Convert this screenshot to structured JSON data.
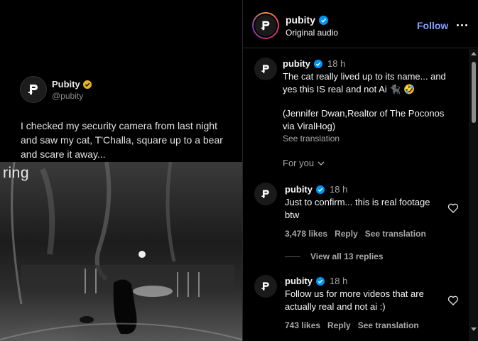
{
  "media": {
    "tweet": {
      "name": "Pubity",
      "handle": "@pubity",
      "text": "I checked my security camera from last night and saw my cat, T'Challa, square up to a bear and scare it away..."
    },
    "watermark": "ring"
  },
  "header": {
    "username": "pubity",
    "subtitle": "Original audio",
    "follow_label": "Follow",
    "more_icon": "more-horizontal-icon"
  },
  "caption": {
    "username": "pubity",
    "time": "18 h",
    "line1": "The cat really lived up to its name... and",
    "line2": "yes this IS real and not Ai 🐈‍⬛ 🤣",
    "line3": "(Jennifer Dwan,Realtor of The Poconos",
    "line4": "via ViralHog)",
    "see_translation": "See translation"
  },
  "for_you_label": "For you",
  "comments": [
    {
      "username": "pubity",
      "time": "18 h",
      "line1": "Just to confirm... this is real footage",
      "line2": "btw",
      "likes": "3,478 likes",
      "reply": "Reply",
      "see_translation": "See translation",
      "view_replies": "View all 13 replies"
    },
    {
      "username": "pubity",
      "time": "18 h",
      "line1": "Follow us for more videos that are",
      "line2": "actually real and not ai :)",
      "likes": "743 likes",
      "reply": "Reply",
      "see_translation": "See translation"
    }
  ],
  "colors": {
    "verified": "#0095f6",
    "follow": "#85a1ff",
    "secondary_text": "#a8a8a8"
  }
}
